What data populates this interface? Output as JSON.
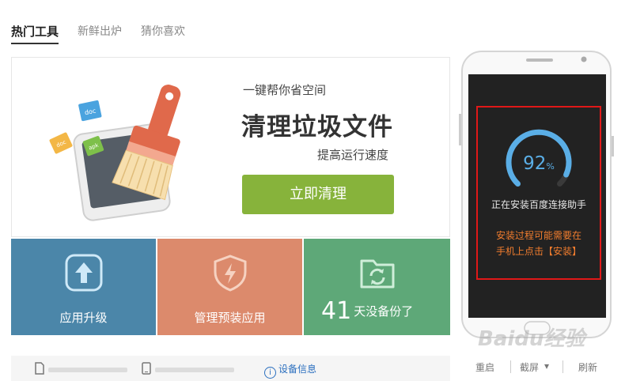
{
  "tabs": [
    {
      "label": "热门工具",
      "active": true
    },
    {
      "label": "新鲜出炉",
      "active": false
    },
    {
      "label": "猜你喜欢",
      "active": false
    }
  ],
  "feature": {
    "tagline": "一键帮你省空间",
    "headline": "清理垃圾文件",
    "subline": "提高运行速度",
    "button_label": "立即清理",
    "illustration": {
      "icon": "broom-phone-illustration",
      "file_badges": [
        "doc",
        "doc",
        "apk"
      ]
    }
  },
  "tiles": [
    {
      "label": "应用升级",
      "icon": "upgrade-arrow-icon",
      "color": "#4b86a9"
    },
    {
      "label": "管理预装应用",
      "icon": "shield-bolt-icon",
      "color": "#dc8a6c"
    },
    {
      "backup_count": "41",
      "label": "天没备份了",
      "icon": "folder-sync-icon",
      "color": "#5ea878"
    }
  ],
  "bottom_bar": {
    "device_info_label": "设备信息",
    "icons": [
      "sd-card-icon",
      "phone-storage-icon"
    ]
  },
  "phone": {
    "progress_value": "92",
    "progress_unit": "%",
    "progress_fraction": 0.92,
    "status_text": "正在安装百度连接助手",
    "warning_line1": "安装过程可能需要在",
    "warning_line2": "手机上点击【安装】",
    "actions": [
      "重启",
      "截屏",
      "刷新"
    ]
  },
  "watermark": "Baidu经验",
  "colors": {
    "accent_green": "#87b33b",
    "warning_orange": "#f27d2e",
    "gauge_blue": "#5aaee6",
    "highlight_red": "#e01818"
  }
}
